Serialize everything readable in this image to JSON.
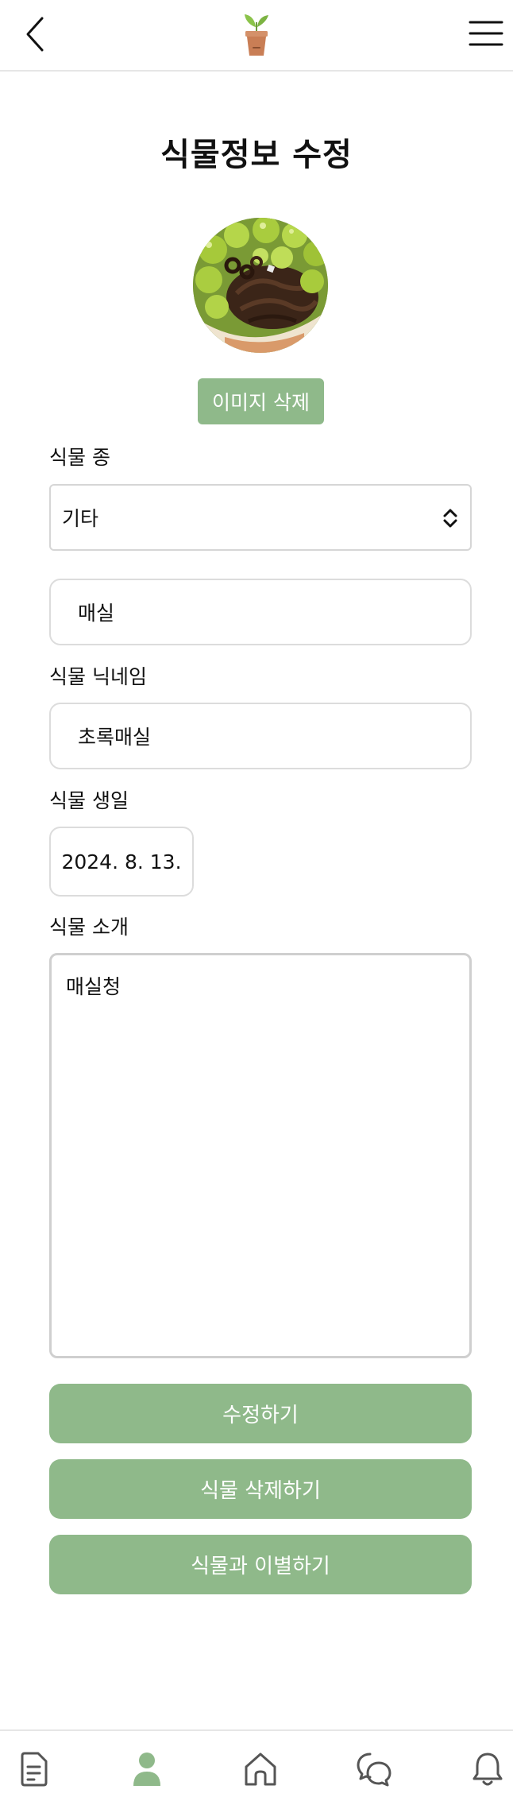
{
  "header": {
    "back_icon": "chevron-left-icon",
    "logo_icon": "potted-sprout-logo",
    "menu_icon": "hamburger-menu-icon"
  },
  "page": {
    "title": "식물정보 수정"
  },
  "image": {
    "delete_label": "이미지 삭제"
  },
  "form": {
    "species_label": "식물 종",
    "species_select_value": "기타",
    "species_custom_value": "매실",
    "nickname_label": "식물 닉네임",
    "nickname_value": "초록매실",
    "birthday_label": "식물 생일",
    "birthday_value": "2024. 8. 13.",
    "intro_label": "식물 소개",
    "intro_value": "매실청"
  },
  "actions": {
    "edit_label": "수정하기",
    "delete_label": "식물 삭제하기",
    "farewell_label": "식물과 이별하기"
  },
  "colors": {
    "accent_green": "#8fb98a",
    "nav_active": "#8fb98a",
    "nav_inactive": "#555555"
  },
  "bottom_nav": {
    "items": [
      "diary-icon",
      "profile-icon",
      "home-icon",
      "chat-icon",
      "bell-icon"
    ],
    "active": "profile-icon"
  }
}
